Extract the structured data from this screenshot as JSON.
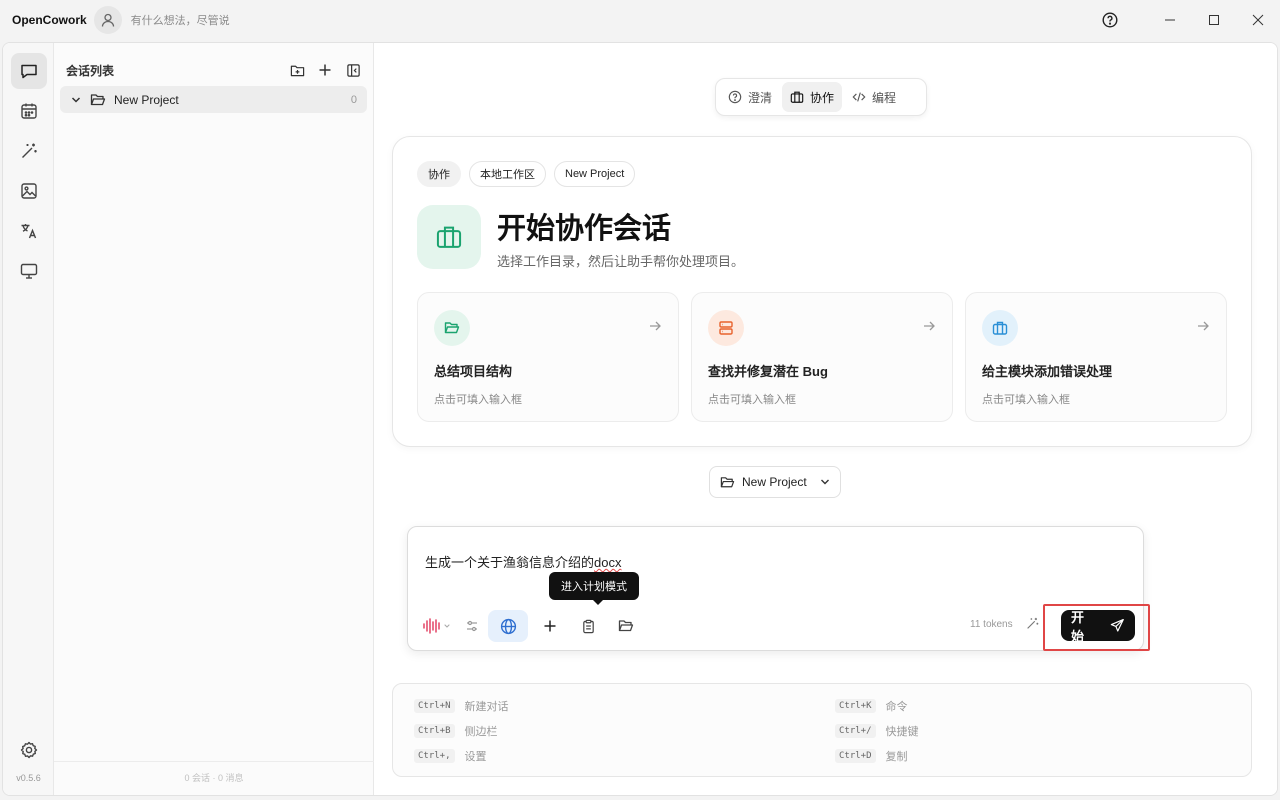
{
  "titlebar": {
    "app_name": "OpenCowork",
    "hint": "有什么想法，尽管说"
  },
  "rail": {
    "icons": [
      "chat-icon",
      "calendar-icon",
      "magic-wand-icon",
      "image-icon",
      "translate-icon",
      "monitor-icon"
    ],
    "settings_icon": "gear-icon",
    "version": "v0.5.6"
  },
  "sidebar": {
    "title": "会话列表",
    "project": {
      "name": "New Project",
      "count": "0"
    },
    "footer": "0 会话 · 0 消息"
  },
  "modes": [
    {
      "label": "澄清",
      "icon": "question-circle-icon"
    },
    {
      "label": "协作",
      "icon": "briefcase-icon",
      "active": true
    },
    {
      "label": "编程",
      "icon": "code-icon"
    }
  ],
  "hero": {
    "tags": [
      "协作",
      "本地工作区",
      "New Project"
    ],
    "title": "开始协作会话",
    "subtitle": "选择工作目录，然后让助手帮你处理项目。"
  },
  "suggestions": [
    {
      "title": "总结项目结构",
      "hint": "点击可填入输入框",
      "color": "#1aa36f",
      "bg": "#e4f5ed"
    },
    {
      "title": "查找并修复潜在 Bug",
      "hint": "点击可填入输入框",
      "color": "#e8622c",
      "bg": "#fde9df"
    },
    {
      "title": "给主模块添加错误处理",
      "hint": "点击可填入输入框",
      "color": "#2a8fd6",
      "bg": "#e2f1fb"
    }
  ],
  "project_selector": {
    "label": "New Project"
  },
  "composer": {
    "text_before": "生成一个关于渔翁信息介绍的",
    "text_error_word": "docx",
    "tooltip": "进入计划模式",
    "tokens": "11 tokens",
    "start_label": "开始"
  },
  "shortcuts": [
    {
      "key": "Ctrl+N",
      "label": "新建对话"
    },
    {
      "key": "Ctrl+K",
      "label": "命令"
    },
    {
      "key": "Ctrl+B",
      "label": "侧边栏"
    },
    {
      "key": "Ctrl+/",
      "label": "快捷键"
    },
    {
      "key": "Ctrl+,",
      "label": "设置"
    },
    {
      "key": "Ctrl+D",
      "label": "复制"
    }
  ],
  "colors": {
    "accent_green": "#1aa36f",
    "highlight_red": "#e04646",
    "active_tool_blue": "#2f6fd0"
  }
}
